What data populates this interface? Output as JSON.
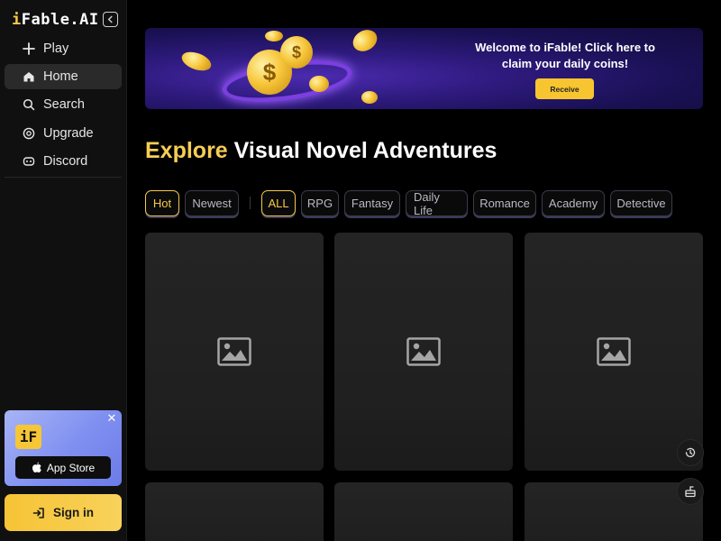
{
  "brand": {
    "logo_lead": "i",
    "logo_rest": "Fable.AI"
  },
  "sidebar": {
    "items": [
      {
        "label": "Play",
        "icon": "plus-icon",
        "active": false
      },
      {
        "label": "Home",
        "icon": "home-icon",
        "active": true
      },
      {
        "label": "Search",
        "icon": "search-icon",
        "active": false
      },
      {
        "label": "Upgrade",
        "icon": "upgrade-icon",
        "active": false
      },
      {
        "label": "Discord",
        "icon": "discord-icon",
        "active": false
      }
    ],
    "promo": {
      "logo_text": "iF",
      "appstore_label": "App Store",
      "close_icon": "close-icon"
    },
    "signin_label": "Sign in"
  },
  "banner": {
    "line1": "Welcome to iFable! Click here to",
    "line2": "claim your daily coins!",
    "button": "Receive",
    "coin_symbol": "$"
  },
  "heading": {
    "accent": "Explore",
    "rest": "Visual Novel Adventures"
  },
  "sort_tabs": [
    {
      "label": "Hot",
      "active": true
    },
    {
      "label": "Newest",
      "active": false
    }
  ],
  "genres": [
    {
      "label": "ALL",
      "active": true
    },
    {
      "label": "RPG",
      "active": false
    },
    {
      "label": "Fantasy",
      "active": false
    },
    {
      "label": "Daily Life",
      "active": false
    },
    {
      "label": "Romance",
      "active": false
    },
    {
      "label": "Academy",
      "active": false
    },
    {
      "label": "Detective",
      "active": false
    }
  ],
  "cards": {
    "count_visible": 6,
    "placeholder_icon": "image-placeholder-icon"
  },
  "floating": [
    "history-icon",
    "mailbox-icon"
  ],
  "colors": {
    "accent": "#f6c94a",
    "bg": "#000000",
    "sidebar": "#101010",
    "card": "#222222"
  }
}
